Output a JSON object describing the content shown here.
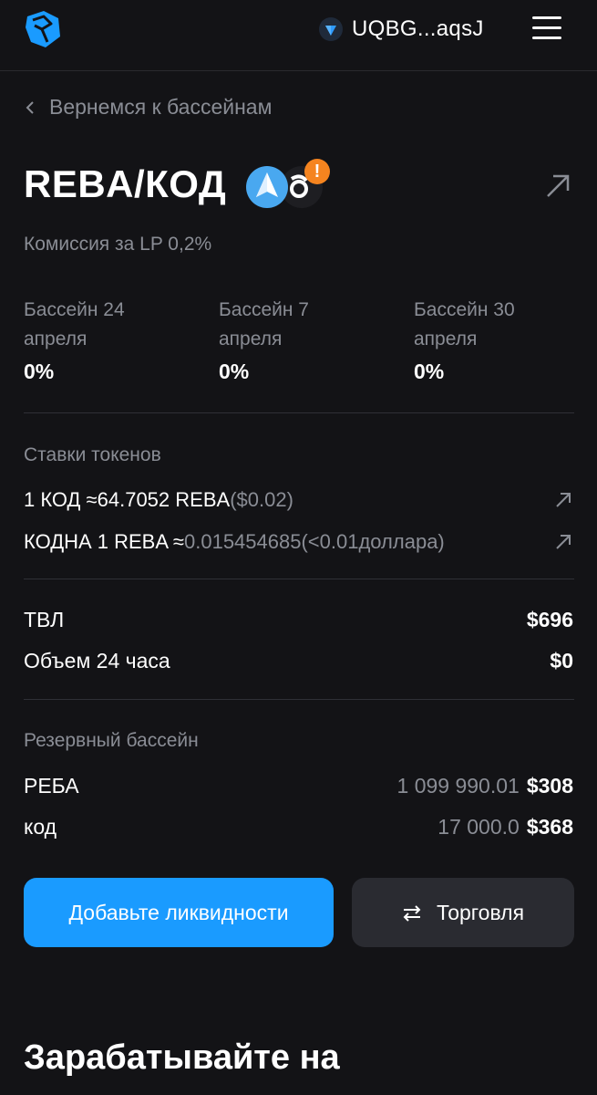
{
  "header": {
    "wallet_address": "UQBG...aqsJ",
    "wallet_icon": "ton-diamond-icon",
    "logo_icon": "ston-logo-icon",
    "menu_icon": "hamburger-menu-icon"
  },
  "back_link": {
    "label": "Вернемся к бассейнам"
  },
  "pool": {
    "title": "REBA/КОД",
    "fee": "Комиссия за LP 0,2%",
    "warning_badge": "!"
  },
  "stats": [
    {
      "label": "Бассейн 24 апреля",
      "value": "0%"
    },
    {
      "label": "Бассейн 7 апреля",
      "value": "0%"
    },
    {
      "label": "Бассейн 30 апреля",
      "value": "0%"
    }
  ],
  "token_rates": {
    "section_label": "Ставки токенов",
    "rows": [
      {
        "main": "1 КОД ≈64.7052 REBA",
        "secondary": "($0.02)"
      },
      {
        "main": "КОДНА 1 REBA ≈",
        "secondary": "0.015454685(<0.01доллара)"
      }
    ]
  },
  "metrics": [
    {
      "label": "ТВЛ",
      "value": "$696"
    },
    {
      "label": "Объем 24 часа",
      "value": "$0"
    }
  ],
  "reserves": {
    "section_label": "Резервный бассейн",
    "rows": [
      {
        "label": "РЕБА",
        "amount": "1 099 990.01",
        "usd": "$308"
      },
      {
        "label": "код",
        "amount": "17 000.0",
        "usd": "$368"
      }
    ]
  },
  "actions": {
    "add_liquidity": "Добавьте ликвидности",
    "trade": "Торговля"
  },
  "earn_heading": "Зарабатывайте на",
  "colors": {
    "background": "#131316",
    "accent": "#1a9bff",
    "muted_text": "#8a8d95",
    "warning": "#f5841f"
  }
}
